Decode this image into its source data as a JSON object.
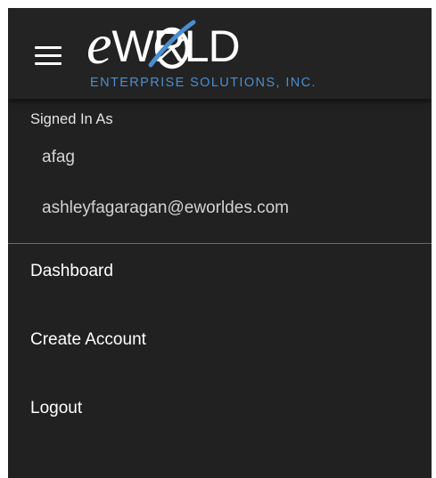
{
  "header": {
    "menu_icon": "hamburger-menu-icon",
    "logo": {
      "text": "eWORLD",
      "e": "e",
      "rest": "WRLD",
      "tagline": "ENTERPRISE SOLUTIONS, INC.",
      "primary_color": "#ffffff",
      "accent_color": "#4a8ed1"
    }
  },
  "account": {
    "signed_in_label": "Signed In As",
    "username": "afag",
    "email": "ashleyfagaragan@eworldes.com"
  },
  "menu": {
    "items": [
      {
        "label": "Dashboard"
      },
      {
        "label": "Create Account"
      },
      {
        "label": "Logout"
      }
    ]
  },
  "colors": {
    "background": "#212121",
    "header": "#232323",
    "divider": "#6a6a6a",
    "text": "#ffffff",
    "muted_text": "#d3d3d3"
  }
}
